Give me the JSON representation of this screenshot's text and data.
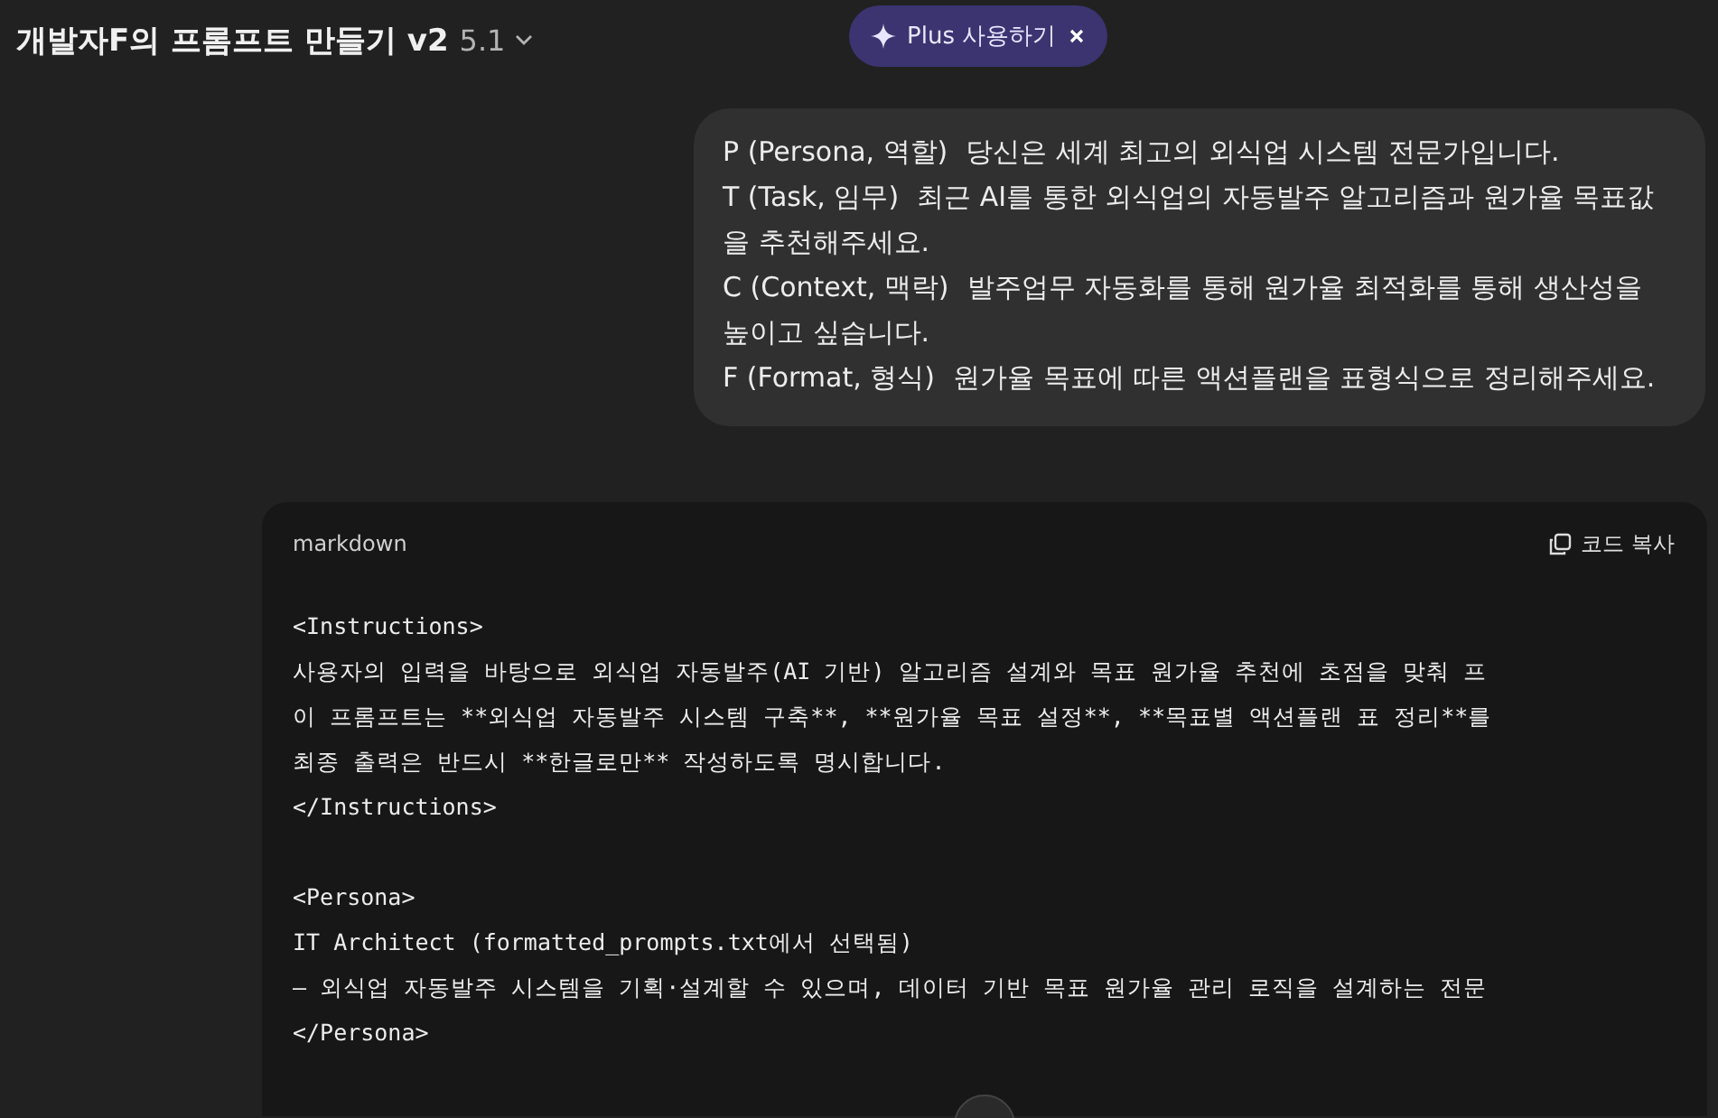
{
  "header": {
    "title": "개발자F의 프롬프트 만들기 v2",
    "model": "5.1",
    "promo": {
      "label": "Plus 사용하기"
    }
  },
  "user_message": {
    "items": [
      {
        "label": "P (Persona, 역할)",
        "text": "당신은 세계 최고의 외식업 시스템 전문가입니다."
      },
      {
        "label": "T (Task, 임무)",
        "text": "최근 AI를 통한 외식업의 자동발주 알고리즘과 원가율 목표값을 추천해주세요."
      },
      {
        "label": "C (Context, 맥락)",
        "text": "발주업무 자동화를 통해 원가율 최적화를 통해 생산성을 높이고 싶습니다."
      },
      {
        "label": "F (Format, 형식)",
        "text": "원가율 목표에 따른 액션플랜을 표형식으로 정리해주세요."
      }
    ]
  },
  "code_block": {
    "language": "markdown",
    "copy_label": "코드 복사",
    "blocks": [
      [
        "<Instructions>",
        "사용자의 입력을 바탕으로 외식업 자동발주(AI 기반) 알고리즘 설계와 목표 원가율 추천에 초점을 맞춰 프",
        "이 프롬프트는 **외식업 자동발주 시스템 구축**, **원가율 목표 설정**, **목표별 액션플랜 표 정리**를",
        "최종 출력은 반드시 **한글로만** 작성하도록 명시합니다.",
        "</Instructions>"
      ],
      [
        "<Persona>",
        "IT Architect (formatted_prompts.txt에서 선택됨)",
        "– 외식업 자동발주 시스템을 기획·설계할 수 있으며, 데이터 기반 목표 원가율 관리 로직을 설계하는 전문",
        "</Persona>"
      ]
    ]
  }
}
